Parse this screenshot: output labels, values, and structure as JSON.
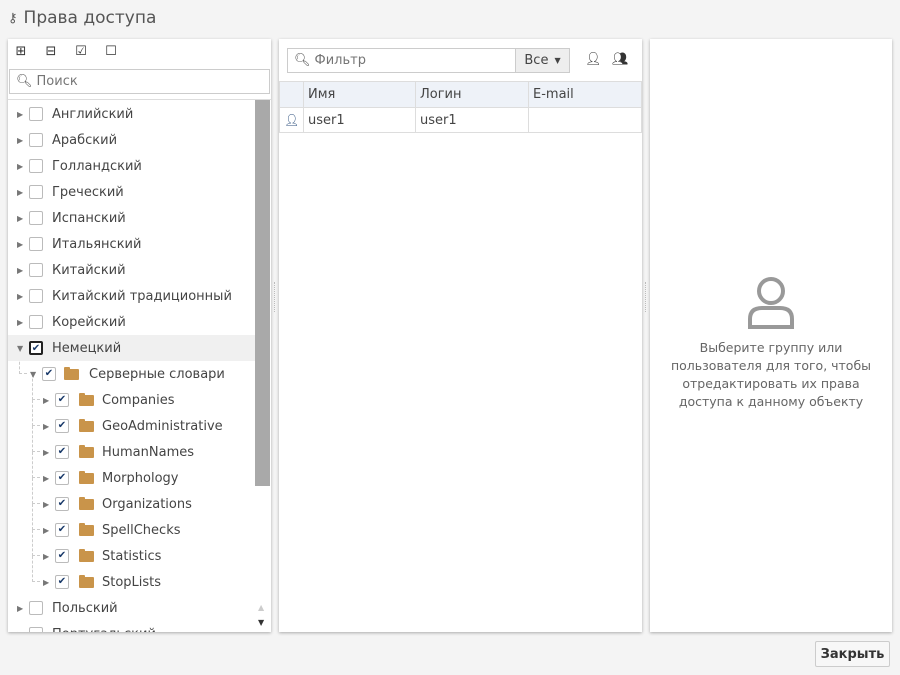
{
  "title": "Права доступа",
  "left": {
    "toolbar": [
      {
        "icon": "expand-all-icon",
        "glyph": "⊞"
      },
      {
        "icon": "collapse-all-icon",
        "glyph": "⊟"
      },
      {
        "icon": "check-all-icon",
        "glyph": "☑"
      },
      {
        "icon": "uncheck-all-icon",
        "glyph": "☐"
      }
    ],
    "search_placeholder": "Поиск",
    "tree": [
      {
        "label": "Английский",
        "level": 0,
        "checked": false,
        "arrow": "right"
      },
      {
        "label": "Арабский",
        "level": 0,
        "checked": false,
        "arrow": "right"
      },
      {
        "label": "Голландский",
        "level": 0,
        "checked": false,
        "arrow": "right"
      },
      {
        "label": "Греческий",
        "level": 0,
        "checked": false,
        "arrow": "right"
      },
      {
        "label": "Испанский",
        "level": 0,
        "checked": false,
        "arrow": "right"
      },
      {
        "label": "Итальянский",
        "level": 0,
        "checked": false,
        "arrow": "right"
      },
      {
        "label": "Китайский",
        "level": 0,
        "checked": false,
        "arrow": "right"
      },
      {
        "label": "Китайский традиционный",
        "level": 0,
        "checked": false,
        "arrow": "right"
      },
      {
        "label": "Корейский",
        "level": 0,
        "checked": false,
        "arrow": "right"
      },
      {
        "label": "Немецкий",
        "level": 0,
        "checked": true,
        "arrow": "down",
        "hover": true
      },
      {
        "label": "Серверные словари",
        "level": 1,
        "checked": true,
        "arrow": "down",
        "folder": true
      },
      {
        "label": "Companies",
        "level": 2,
        "checked": true,
        "arrow": "right",
        "folder": true
      },
      {
        "label": "GeoAdministrative",
        "level": 2,
        "checked": true,
        "arrow": "right",
        "folder": true
      },
      {
        "label": "HumanNames",
        "level": 2,
        "checked": true,
        "arrow": "right",
        "folder": true
      },
      {
        "label": "Morphology",
        "level": 2,
        "checked": true,
        "arrow": "right",
        "folder": true
      },
      {
        "label": "Organizations",
        "level": 2,
        "checked": true,
        "arrow": "right",
        "folder": true
      },
      {
        "label": "SpellChecks",
        "level": 2,
        "checked": true,
        "arrow": "right",
        "folder": true
      },
      {
        "label": "Statistics",
        "level": 2,
        "checked": true,
        "arrow": "right",
        "folder": true
      },
      {
        "label": "StopLists",
        "level": 2,
        "checked": true,
        "arrow": "right",
        "folder": true
      },
      {
        "label": "Польский",
        "level": 0,
        "checked": false,
        "arrow": "right"
      },
      {
        "label": "Португальский",
        "level": 0,
        "checked": false,
        "arrow": "right"
      }
    ]
  },
  "mid": {
    "filter_placeholder": "Фильтр",
    "select_value": "Все",
    "columns": [
      "Имя",
      "Логин",
      "E-mail"
    ],
    "rows": [
      {
        "icon": "user-icon",
        "name": "user1",
        "login": "user1",
        "email": ""
      }
    ]
  },
  "right": {
    "empty_message": "Выберите группу или пользователя для того, чтобы отредактировать их права доступа к данному объекту"
  },
  "close_label": "Закрыть",
  "colors": {
    "folder": "#c9944a",
    "user_icon": "#2c4f7c"
  }
}
